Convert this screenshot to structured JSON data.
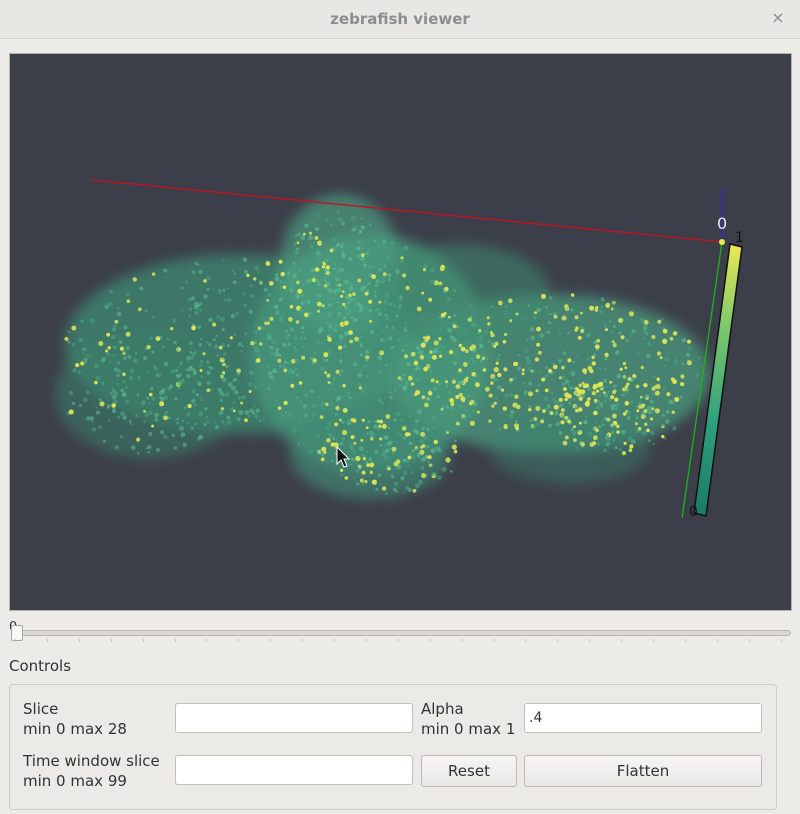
{
  "window": {
    "title": "zebrafish viewer",
    "close_glyph": "×"
  },
  "viewer": {
    "axis_marks": [
      "0",
      "1",
      "0"
    ],
    "background_color": "#3c3f4a",
    "red_axis_color": "#c0141e",
    "green_axis_color": "#1db31b",
    "blue_axis_color": "#2a2ac8",
    "colorbar": {
      "min": "0",
      "max": "1",
      "colors": [
        "#1a7a63",
        "#2fa07e",
        "#7ec86a",
        "#eaea53"
      ]
    }
  },
  "time_slider": {
    "value_label": "0",
    "value": 0,
    "min": 0,
    "max": 99
  },
  "controls": {
    "title": "Controls",
    "slice": {
      "label": "Slice",
      "range": "min 0 max 28",
      "value": ""
    },
    "alpha": {
      "label": "Alpha",
      "range": "min 0 max 1",
      "value": ".4"
    },
    "time_window": {
      "label": "Time window slice",
      "range": "min 0 max 99",
      "value": ""
    },
    "reset_label": "Reset",
    "flatten_label": "Flatten"
  }
}
